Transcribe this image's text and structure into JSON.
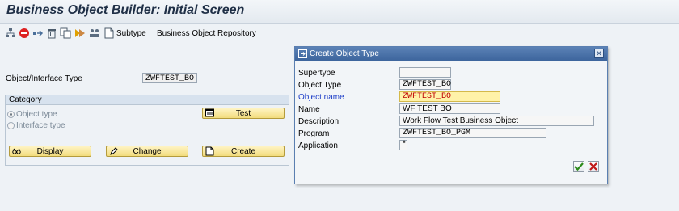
{
  "title": "Business Object Builder: Initial Screen",
  "toolbar": {
    "icons": [
      "hierarchy-icon",
      "stop-icon",
      "forward-icon",
      "delete-icon",
      "copy-icon",
      "generate-icon",
      "org-icon"
    ],
    "subtype_label": "Subtype",
    "repository_label": "Business Object Repository"
  },
  "main": {
    "object_type_label": "Object/Interface Type",
    "object_type_value": "ZWFTEST_BO",
    "category": {
      "header": "Category",
      "object_type": "Object type",
      "interface_type": "Interface type",
      "selected": "object_type"
    },
    "buttons": {
      "test": "Test",
      "display": "Display",
      "change": "Change",
      "create": "Create"
    }
  },
  "dialog": {
    "title": "Create Object Type",
    "fields": {
      "supertype_label": "Supertype",
      "supertype_value": "",
      "object_type_label": "Object Type",
      "object_type_value": "ZWFTEST_BO",
      "object_name_label": "Object name",
      "object_name_value": "ZWFTEST_BO",
      "name_label": "Name",
      "name_value": "WF TEST BO",
      "description_label": "Description",
      "description_value": "Work Flow Test Business Object",
      "program_label": "Program",
      "program_value": "ZWFTEST_BO_PGM",
      "application_label": "Application",
      "application_value": "*"
    }
  },
  "colors": {
    "accent": "#3d659d",
    "button": "#f2dc7d",
    "error_field": "#fff2a8",
    "error_text": "#c00000",
    "label_blue": "#1b3cc7"
  }
}
